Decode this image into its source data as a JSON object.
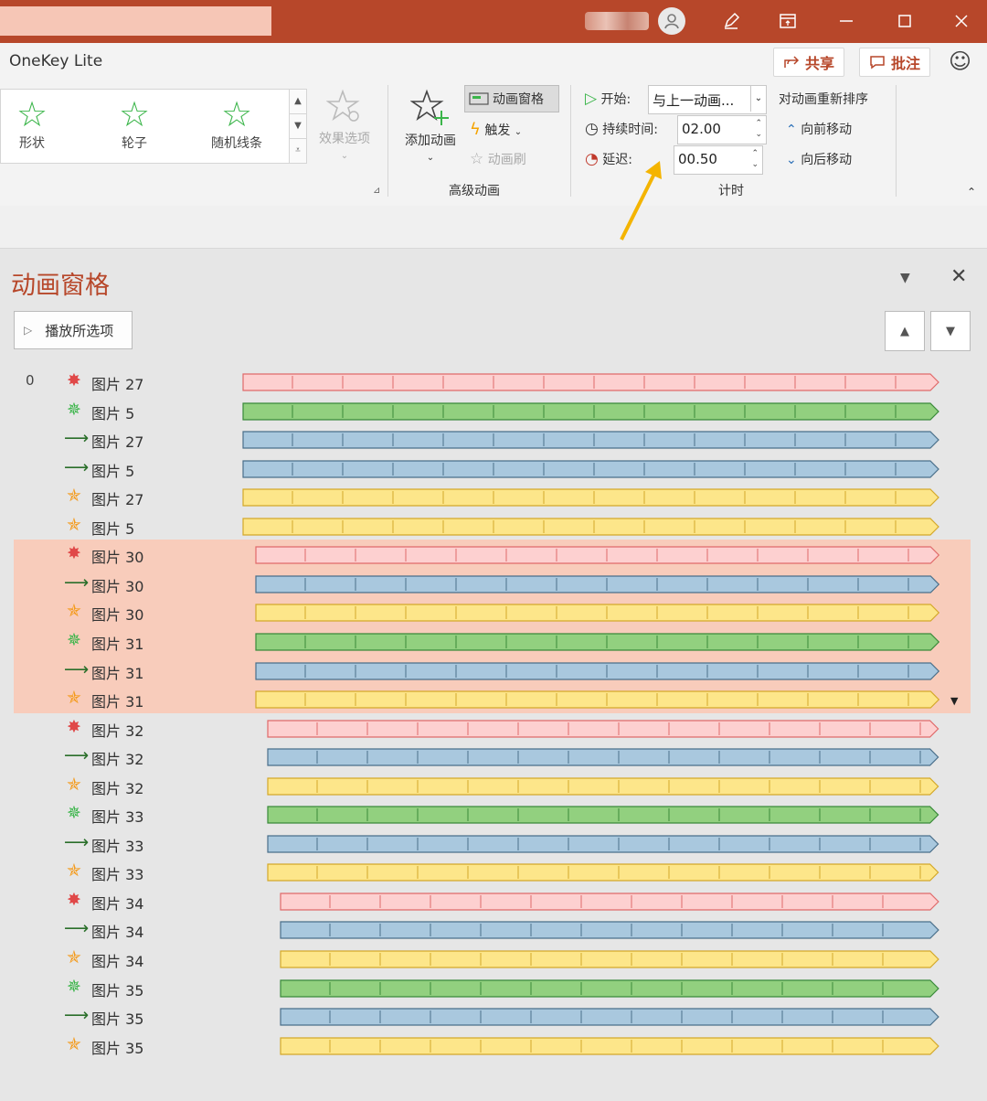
{
  "app": {
    "name": "OneKey Lite"
  },
  "header": {
    "share_label": "共享",
    "comment_label": "批注"
  },
  "gallery": {
    "items": [
      {
        "label": "形状",
        "icon": "star-icon"
      },
      {
        "label": "轮子",
        "icon": "star-wheel-icon"
      },
      {
        "label": "随机线条",
        "icon": "star-lines-icon"
      }
    ],
    "effect_options_label": "效果选项"
  },
  "advanced": {
    "add_animation_label": "添加动画",
    "animation_pane_label": "动画窗格",
    "trigger_label": "触发",
    "painter_label": "动画刷",
    "group_label": "高级动画"
  },
  "timing": {
    "start_label": "开始:",
    "start_value": "与上一动画...",
    "duration_label": "持续时间:",
    "duration_value": "02.00",
    "delay_label": "延迟:",
    "delay_value": "00.50",
    "reorder_label": "对动画重新排序",
    "move_earlier_label": "向前移动",
    "move_later_label": "向后移动",
    "group_label": "计时"
  },
  "pane": {
    "title": "动画窗格",
    "play_label": "播放所选项"
  },
  "colors": {
    "accent": "#b7472a",
    "pink": "#fdd0d0",
    "green": "#92d07f",
    "blue": "#a9c8de",
    "yellow": "#fde68a",
    "selection": "#f8ccbb"
  },
  "rows": [
    {
      "num": "0",
      "type": "pink",
      "name": "图片 27",
      "offset": 0
    },
    {
      "num": "",
      "type": "green",
      "name": "图片 5",
      "offset": 0
    },
    {
      "num": "",
      "type": "blue",
      "name": "图片 27",
      "offset": 0
    },
    {
      "num": "",
      "type": "blue",
      "name": "图片 5",
      "offset": 0
    },
    {
      "num": "",
      "type": "yellow",
      "name": "图片 27",
      "offset": 0
    },
    {
      "num": "",
      "type": "yellow",
      "name": "图片 5",
      "offset": 0
    },
    {
      "num": "",
      "type": "pink",
      "name": "图片 30",
      "offset": 1,
      "selected": true
    },
    {
      "num": "",
      "type": "blue",
      "name": "图片 30",
      "offset": 1,
      "selected": true
    },
    {
      "num": "",
      "type": "yellow",
      "name": "图片 30",
      "offset": 1,
      "selected": true
    },
    {
      "num": "",
      "type": "green",
      "name": "图片 31",
      "offset": 1,
      "selected": true
    },
    {
      "num": "",
      "type": "blue",
      "name": "图片 31",
      "offset": 1,
      "selected": true
    },
    {
      "num": "",
      "type": "yellow",
      "name": "图片 31",
      "offset": 1,
      "selected": true
    },
    {
      "num": "",
      "type": "pink",
      "name": "图片 32",
      "offset": 2
    },
    {
      "num": "",
      "type": "blue",
      "name": "图片 32",
      "offset": 2
    },
    {
      "num": "",
      "type": "yellow",
      "name": "图片 32",
      "offset": 2
    },
    {
      "num": "",
      "type": "green",
      "name": "图片 33",
      "offset": 2
    },
    {
      "num": "",
      "type": "blue",
      "name": "图片 33",
      "offset": 2
    },
    {
      "num": "",
      "type": "yellow",
      "name": "图片 33",
      "offset": 2
    },
    {
      "num": "",
      "type": "pink",
      "name": "图片 34",
      "offset": 3
    },
    {
      "num": "",
      "type": "blue",
      "name": "图片 34",
      "offset": 3
    },
    {
      "num": "",
      "type": "yellow",
      "name": "图片 34",
      "offset": 3
    },
    {
      "num": "",
      "type": "green",
      "name": "图片 35",
      "offset": 3
    },
    {
      "num": "",
      "type": "blue",
      "name": "图片 35",
      "offset": 3
    },
    {
      "num": "",
      "type": "yellow",
      "name": "图片 35",
      "offset": 3
    }
  ]
}
